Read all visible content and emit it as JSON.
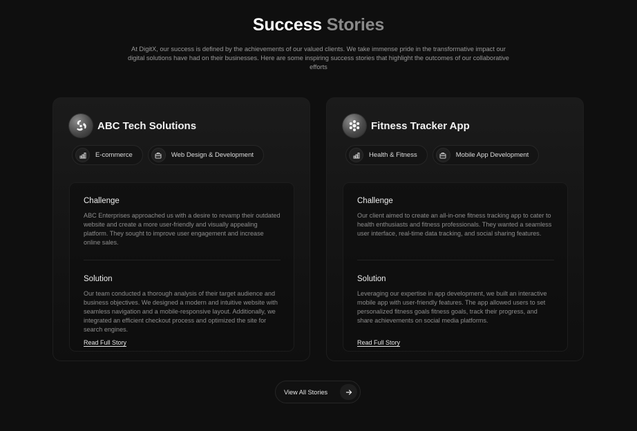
{
  "header": {
    "title_main": "Success",
    "title_accent": "Stories",
    "intro": "At DigitX, our success is defined by the achievements of our valued clients. We take immense pride in the transformative impact our digital solutions have had on their businesses. Here are some inspiring success stories that highlight the outcomes of our collaborative efforts"
  },
  "cards": [
    {
      "title": "ABC Tech Solutions",
      "logo_icon": "triskelion-icon",
      "tags": [
        {
          "icon": "bar-chart-icon",
          "label": "E-commerce"
        },
        {
          "icon": "briefcase-icon",
          "label": "Web Design & Development"
        }
      ],
      "challenge_title": "Challenge",
      "challenge_text": "ABC Enterprises approached us with a desire to revamp their outdated website and create a more user-friendly and visually appealing platform. They sought to improve user engagement and increase online sales.",
      "solution_title": "Solution",
      "solution_text": "Our team conducted a thorough analysis of their target audience and business objectives. We designed a modern and intuitive website with seamless navigation and a mobile-responsive layout. Additionally, we integrated an efficient checkout process and optimized the site for search engines.",
      "link": "Read Full Story"
    },
    {
      "title": "Fitness Tracker App",
      "logo_icon": "molecule-icon",
      "tags": [
        {
          "icon": "bar-chart-icon",
          "label": "Health & Fitness"
        },
        {
          "icon": "briefcase-icon",
          "label": "Mobile App Development"
        }
      ],
      "challenge_title": "Challenge",
      "challenge_text": "Our client aimed to create an all-in-one fitness tracking app to cater to health enthusiasts and fitness professionals. They wanted a seamless user interface, real-time data tracking, and social sharing features.",
      "solution_title": "Solution",
      "solution_text": "Leveraging our expertise in app development, we built an interactive mobile app with user-friendly features. The app allowed users to set personalized fitness goals fitness goals, track their progress, and share achievements on social media platforms.",
      "link": "Read Full Story"
    }
  ],
  "footer": {
    "view_all": "View All Stories",
    "arrow_icon": "arrow-right-icon"
  },
  "colors": {
    "background": "#0f0f0f",
    "accent_gray": "#8a8a8a",
    "text_muted": "#8e8e8e"
  }
}
